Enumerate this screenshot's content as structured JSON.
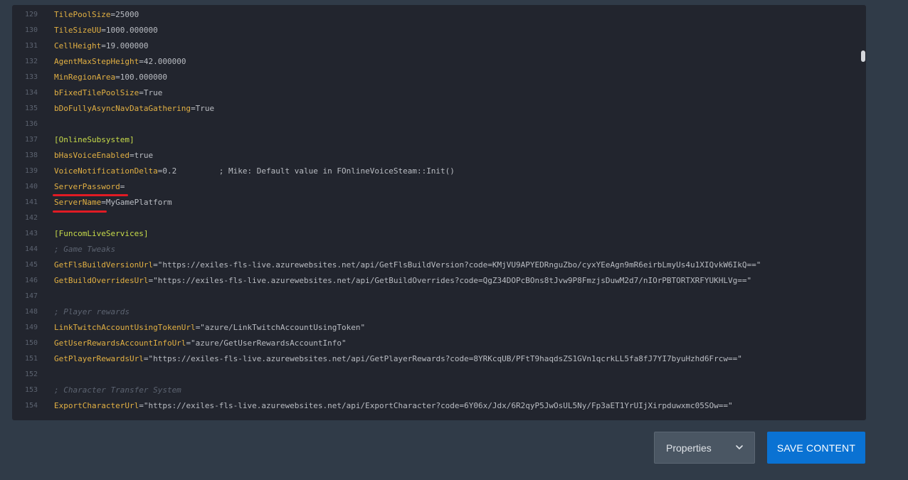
{
  "editor": {
    "lines": [
      {
        "num": "129",
        "key": "TilePoolSize",
        "rest": "=25000",
        "kind": "kv"
      },
      {
        "num": "130",
        "key": "TileSizeUU",
        "rest": "=1000.000000",
        "kind": "kv"
      },
      {
        "num": "131",
        "key": "CellHeight",
        "rest": "=19.000000",
        "kind": "kv"
      },
      {
        "num": "132",
        "key": "AgentMaxStepHeight",
        "rest": "=42.000000",
        "kind": "kv"
      },
      {
        "num": "133",
        "key": "MinRegionArea",
        "rest": "=100.000000",
        "kind": "kv"
      },
      {
        "num": "134",
        "key": "bFixedTilePoolSize",
        "rest": "=True",
        "kind": "kv"
      },
      {
        "num": "135",
        "key": "bDoFullyAsyncNavDataGathering",
        "rest": "=True",
        "kind": "kv"
      },
      {
        "num": "136",
        "key": "",
        "rest": "",
        "kind": "blank"
      },
      {
        "num": "137",
        "key": "[OnlineSubsystem]",
        "rest": "",
        "kind": "section"
      },
      {
        "num": "138",
        "key": "bHasVoiceEnabled",
        "rest": "=true",
        "kind": "kv"
      },
      {
        "num": "139",
        "key": "VoiceNotificationDelta",
        "rest": "=0.2         ; Mike: Default value in FOnlineVoiceSteam::Init()",
        "kind": "kv"
      },
      {
        "num": "140",
        "key": "ServerPassword",
        "rest": "=",
        "kind": "kv"
      },
      {
        "num": "141",
        "key": "ServerName",
        "rest": "=MyGamePlatform",
        "kind": "kv"
      },
      {
        "num": "142",
        "key": "",
        "rest": "",
        "kind": "blank"
      },
      {
        "num": "143",
        "key": "[FuncomLiveServices]",
        "rest": "",
        "kind": "section"
      },
      {
        "num": "144",
        "key": "; Game Tweaks",
        "rest": "",
        "kind": "comment"
      },
      {
        "num": "145",
        "key": "GetFlsBuildVersionUrl",
        "rest": "=\"https://exiles-fls-live.azurewebsites.net/api/GetFlsBuildVersion?code=KMjVU9APYEDRnguZbo/cyxYEeAgn9mR6eirbLmyUs4u1XIQvkW6IkQ==\"",
        "kind": "kv"
      },
      {
        "num": "146",
        "key": "GetBuildOverridesUrl",
        "rest": "=\"https://exiles-fls-live.azurewebsites.net/api/GetBuildOverrides?code=QgZ34DOPcBOns8tJvw9P8FmzjsDuwM2d7/nIOrPBTORTXRFYUKHLVg==\"",
        "kind": "kv"
      },
      {
        "num": "147",
        "key": "",
        "rest": "",
        "kind": "blank"
      },
      {
        "num": "148",
        "key": "; Player rewards",
        "rest": "",
        "kind": "comment"
      },
      {
        "num": "149",
        "key": "LinkTwitchAccountUsingTokenUrl",
        "rest": "=\"azure/LinkTwitchAccountUsingToken\"",
        "kind": "kv"
      },
      {
        "num": "150",
        "key": "GetUserRewardsAccountInfoUrl",
        "rest": "=\"azure/GetUserRewardsAccountInfo\"",
        "kind": "kv"
      },
      {
        "num": "151",
        "key": "GetPlayerRewardsUrl",
        "rest": "=\"https://exiles-fls-live.azurewebsites.net/api/GetPlayerRewards?code=8YRKcqUB/PFtT9haqdsZS1GVn1qcrkLL5fa8fJ7YI7byuHzhd6Frcw==\"",
        "kind": "kv"
      },
      {
        "num": "152",
        "key": "",
        "rest": "",
        "kind": "blank"
      },
      {
        "num": "153",
        "key": "; Character Transfer System",
        "rest": "",
        "kind": "comment"
      },
      {
        "num": "154",
        "key": "ExportCharacterUrl",
        "rest": "=\"https://exiles-fls-live.azurewebsites.net/api/ExportCharacter?code=6Y06x/Jdx/6R2qyP5JwOsUL5Ny/Fp3aET1YrUIjXirpduwxmc05SOw==\"",
        "kind": "kv"
      }
    ]
  },
  "footer": {
    "select_label": "Properties",
    "save_label": "SAVE CONTENT"
  },
  "colors": {
    "background": "#303b48",
    "editor_bg": "#22252e",
    "key": "#e2b043",
    "section": "#c8dc4a",
    "annotation_underline": "#e01b24",
    "save_button": "#0a72d3"
  }
}
